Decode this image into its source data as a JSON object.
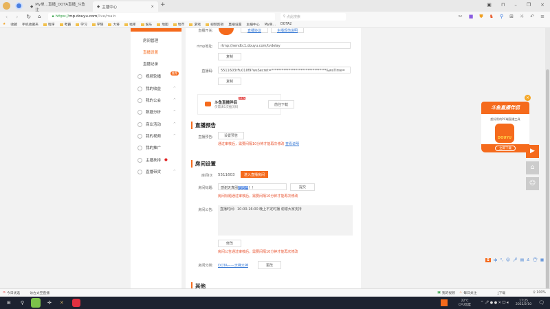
{
  "browser": {
    "tabs": [
      {
        "label": "My单...直播_DOTA直播_斗鱼注"
      },
      {
        "label": "主播中心"
      }
    ],
    "new_tab": "+",
    "url_prefix": "https://",
    "url_host": "mp.douyu.com",
    "url_path": "/live/main",
    "search_placeholder": "点此搜索",
    "bookmarks": [
      "收藏",
      "手机收藏夹",
      "程序",
      "考霸",
      "学习",
      "学院",
      "大将",
      "福库",
      "娱乐",
      "地图",
      "地市",
      "游戏",
      "视频剪辑",
      "直播设置",
      "主播中心",
      "My单...",
      "DOTA2"
    ]
  },
  "sidebar": {
    "items": [
      {
        "label": "房间管理"
      },
      {
        "label": "直播设置",
        "active": true
      },
      {
        "label": "直播记录"
      },
      {
        "label": "视频轮播",
        "badge": "推荐"
      },
      {
        "label": "我的收益"
      },
      {
        "label": "我的公会"
      },
      {
        "label": "数据分析"
      },
      {
        "label": "商业活动"
      },
      {
        "label": "我的视频"
      },
      {
        "label": "我的推广"
      },
      {
        "label": "主播扶持"
      },
      {
        "label": "直播带货"
      }
    ]
  },
  "main": {
    "switch_label": "直播开关:",
    "top_link1": "直播协议",
    "top_link2": "主播规范说明",
    "rtmp_label": "rtmp地址:",
    "rtmp_value": "rtmp://sendtc1.douyu.com/tvdelay",
    "copy": "复制",
    "code_label": "直播码:",
    "code_value": "5511603rFu01Ilf9?wsSecret=********************************&wsTime=",
    "companion": {
      "title": "斗鱼直播伴侣",
      "new": "NEW",
      "sub": "仅需填1次推流码",
      "button": "前往下载"
    },
    "preview": {
      "title": "直播预告",
      "label": "直播预告:",
      "button": "设置预告",
      "warn": "通过审核后，需要间隔10分钟才能再次修改",
      "link": "查看说明"
    },
    "room": {
      "title": "房间设置",
      "id_label": "房间ID:",
      "id_value": "5511603",
      "enter": "进入直播房间",
      "title_label": "房间标题:",
      "title_value": "感谢天真朋",
      "title_selected": "的陪伴",
      "title_rest": "！！",
      "submit": "提交",
      "title_warn": "房间标题通过审核后，需要间隔10分钟才能再次修改",
      "notice_label": "房间公告:",
      "notice_value": "直播时间：10:00-16:00 晚上不定时播 谢谢大家支持",
      "modify": "修改",
      "notice_warn": "房间公告通过审核后，需要间隔10分钟才能再次修改",
      "cat_label": "房间分类:",
      "cat_value": "DOTA——天梯大神",
      "change": "更改"
    },
    "other_title": "其他"
  },
  "ad": {
    "title": "斗鱼直播伴侣",
    "sub": "超好用的PC端直播工具",
    "logo": "DOUYU",
    "button": "立即下载"
  },
  "statusbar": {
    "left1": "今日优选",
    "left2": "访古太空直播",
    "right1": "我的视频",
    "right2": "每日关注",
    "download": "下载",
    "zoom": "100%"
  },
  "taskbar": {
    "temp": "22℃",
    "temp_label": "CPU温度",
    "time": "17:25",
    "date": "2022/2/10"
  }
}
